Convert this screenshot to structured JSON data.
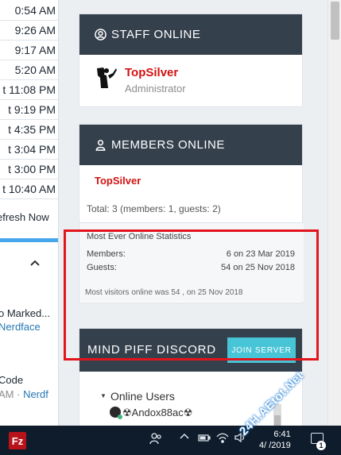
{
  "left_panel": {
    "times": [
      "0:54 AM",
      "9:26 AM",
      "9:17 AM",
      "5:20 AM",
      "t 11:08 PM",
      "t 9:19 PM",
      "t 4:35 PM",
      "t 3:04 PM",
      "t 3:00 PM",
      "t 10:40 AM"
    ],
    "refresh_label": "efresh Now",
    "item1": {
      "line1": "o Marked...",
      "link": "Nerdface"
    },
    "item2": {
      "line1": "Code",
      "prefix": "AM · ",
      "link": "Nerdf"
    }
  },
  "staff_online": {
    "title": "STAFF ONLINE",
    "name": "TopSilver",
    "role": "Administrator"
  },
  "members_online": {
    "title": "MEMBERS ONLINE",
    "member": "TopSilver",
    "total": "Total: 3 (members: 1, guests: 2)",
    "stats_title": "Most Ever Online Statistics",
    "members_label": "Members:",
    "members_value": "6 on 23 Mar 2019",
    "guests_label": "Guests:",
    "guests_value": "54 on 25 Nov 2018",
    "footer": "Most visitors online was 54 , on 25 Nov 2018"
  },
  "discord": {
    "title": "MIND PIFF DISCORD",
    "join_label": "JOIN SERVER",
    "online_users_label": "Online Users",
    "user": "☢Andox88ac☢"
  },
  "taskbar": {
    "app_icon_label": "Fz",
    "time": "6:41",
    "date": "4/  /2019",
    "notification_count": "1"
  },
  "watermark": "24H.AEtot.Net",
  "colors": {
    "header_bg": "#35404d",
    "accent_red": "#d21212",
    "join_button": "#47c5d6",
    "highlight_box": "#e3141c",
    "taskbar_bg": "#0f1c2b"
  }
}
